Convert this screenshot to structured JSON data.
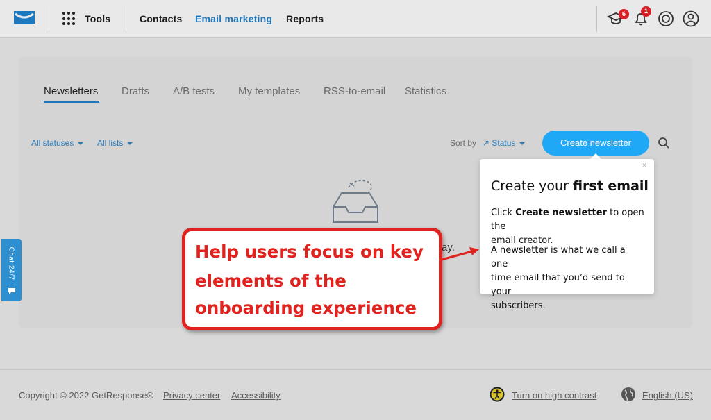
{
  "topbar": {
    "tools_label": "Tools",
    "nav": [
      "Contacts",
      "Email marketing",
      "Reports"
    ],
    "active_nav": "Email marketing",
    "badges": {
      "academy": "6",
      "notifications": "1"
    }
  },
  "tabs": [
    "Newsletters",
    "Drafts",
    "A/B tests",
    "My templates",
    "RSS-to-email",
    "Statistics"
  ],
  "filters": {
    "statuses": "All statuses",
    "lists": "All lists"
  },
  "sort": {
    "label": "Sort by",
    "value": "Status"
  },
  "create_button": "Create newsletter",
  "empty_fragment": "ay.",
  "popover": {
    "close": "×",
    "title_plain": "Create your ",
    "title_bold": "first email",
    "p1_prefix": "Click ",
    "p1_bold": "Create newsletter",
    "p1_suffix_line1": " to open the",
    "p1_line2": "email creator.",
    "p2_line1": "A newsletter is what we call a one-",
    "p2_line2": "time email that you’d send to your",
    "p2_line3": "subscribers."
  },
  "callout": {
    "line1": "Help users focus on key",
    "line2": "elements of the",
    "line3": "onboarding experience"
  },
  "chat_tab": "Chat 24/7",
  "footer": {
    "copyright": "Copyright © 2022 GetResponse®",
    "privacy": "Privacy center",
    "accessibility": "Accessibility",
    "contrast": "Turn on high contrast",
    "language": "English (US)"
  },
  "colors": {
    "accent": "#1c79c0",
    "button": "#1fa8f5",
    "callout_red": "#e0231f",
    "badge_red": "#d81f26",
    "chat_blue": "#2d8fd0"
  },
  "icons": [
    "logo-envelope-icon",
    "tools-grid-icon",
    "academy-cap-icon",
    "bell-icon",
    "lifebuoy-icon",
    "user-icon",
    "search-icon",
    "inbox-tray-icon",
    "chat-bubble-icon",
    "accessibility-icon",
    "globe-icon"
  ]
}
